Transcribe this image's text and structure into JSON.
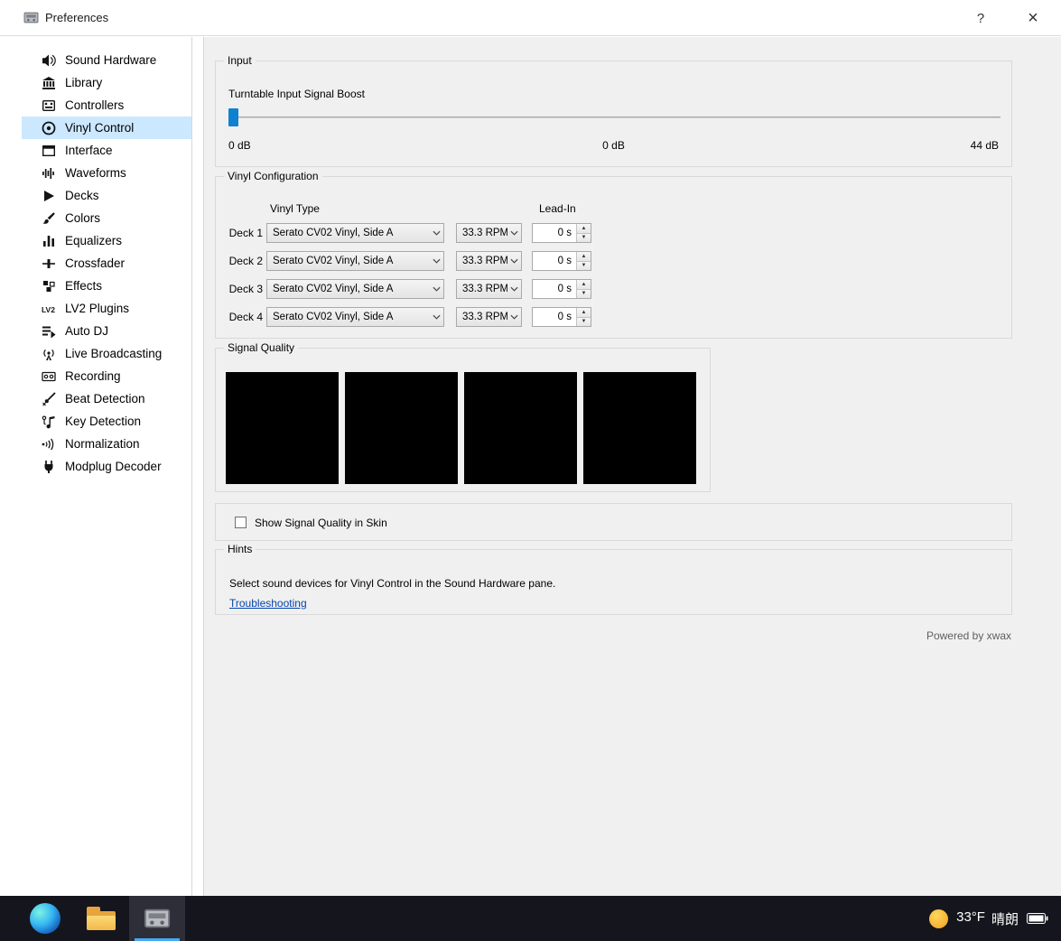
{
  "window": {
    "title": "Preferences",
    "help_label": "?",
    "close_label": "×"
  },
  "sidebar": {
    "items": [
      {
        "label": "Sound Hardware"
      },
      {
        "label": "Library"
      },
      {
        "label": "Controllers"
      },
      {
        "label": "Vinyl Control",
        "selected": true
      },
      {
        "label": "Interface"
      },
      {
        "label": "Waveforms"
      },
      {
        "label": "Decks"
      },
      {
        "label": "Colors"
      },
      {
        "label": "Equalizers"
      },
      {
        "label": "Crossfader"
      },
      {
        "label": "Effects"
      },
      {
        "label": "LV2 Plugins"
      },
      {
        "label": "Auto DJ"
      },
      {
        "label": "Live Broadcasting"
      },
      {
        "label": "Recording"
      },
      {
        "label": "Beat Detection"
      },
      {
        "label": "Key Detection"
      },
      {
        "label": "Normalization"
      },
      {
        "label": "Modplug Decoder"
      }
    ]
  },
  "input_group": {
    "title": "Input",
    "slider_label": "Turntable Input Signal Boost",
    "scale_min": "0 dB",
    "value_current": "0 dB",
    "scale_max": "44 dB"
  },
  "vinyl_config": {
    "title": "Vinyl Configuration",
    "col_vinyl_type": "Vinyl Type",
    "col_lead_in": "Lead-In",
    "decks": [
      {
        "label": "Deck 1",
        "vinyl_type": "Serato CV02 Vinyl, Side A",
        "rpm": "33.3 RPM",
        "lead_in": "0 s"
      },
      {
        "label": "Deck 2",
        "vinyl_type": "Serato CV02 Vinyl, Side A",
        "rpm": "33.3 RPM",
        "lead_in": "0 s"
      },
      {
        "label": "Deck 3",
        "vinyl_type": "Serato CV02 Vinyl, Side A",
        "rpm": "33.3 RPM",
        "lead_in": "0 s"
      },
      {
        "label": "Deck 4",
        "vinyl_type": "Serato CV02 Vinyl, Side A",
        "rpm": "33.3 RPM",
        "lead_in": "0 s"
      }
    ]
  },
  "signal_quality": {
    "title": "Signal Quality",
    "displays": 4
  },
  "skin_option": {
    "label": "Show Signal Quality in Skin",
    "checked": false
  },
  "hints": {
    "title": "Hints",
    "text": "Select sound devices for Vinyl Control in the Sound Hardware pane.",
    "link": "Troubleshooting"
  },
  "footer": {
    "powered_by": "Powered by xwax"
  },
  "taskbar": {
    "temperature": "33°F",
    "condition": "晴朗"
  },
  "colors": {
    "selection_bg": "#cce8ff",
    "slider_handle": "#1081d0",
    "link": "#0645ad",
    "taskbar_bg": "#15151d",
    "taskbar_accent": "#45a8f5"
  }
}
